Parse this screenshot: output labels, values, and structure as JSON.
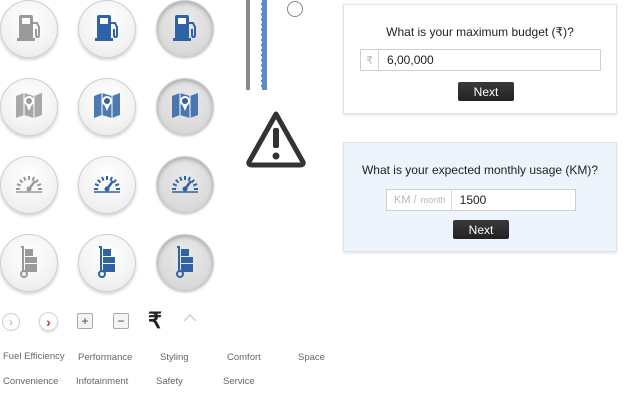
{
  "colors": {
    "icon_gray": "#9a9a9a",
    "icon_blue": "#2f63a6",
    "panel_bg_alt": "#eef4fb",
    "button_bg": "#2d2d2d"
  },
  "icon_rows": [
    {
      "icon": "fuel-pump-icon"
    },
    {
      "icon": "map-pin-icon"
    },
    {
      "icon": "speedometer-icon"
    },
    {
      "icon": "hand-truck-boxes-icon"
    }
  ],
  "controls": {
    "arrow_right_outline": "›",
    "arrow_right_red": "›",
    "plus": "+",
    "minus": "−",
    "rupee": "₹"
  },
  "categories": [
    "Fuel Efficiency",
    "Performance",
    "Styling",
    "Comfort",
    "Space",
    "Convenience",
    "Infotainment",
    "Safety",
    "Service"
  ],
  "budget_card": {
    "question": "What is your maximum budget (₹)?",
    "prefix": "₹",
    "value": "6,00,000",
    "button": "Next"
  },
  "usage_card": {
    "question": "What is your expected monthly usage (KM)?",
    "prefix_km": "KM /",
    "prefix_month": "month",
    "value": "1500",
    "button": "Next"
  },
  "warning": {
    "icon": "warning-triangle-icon"
  }
}
